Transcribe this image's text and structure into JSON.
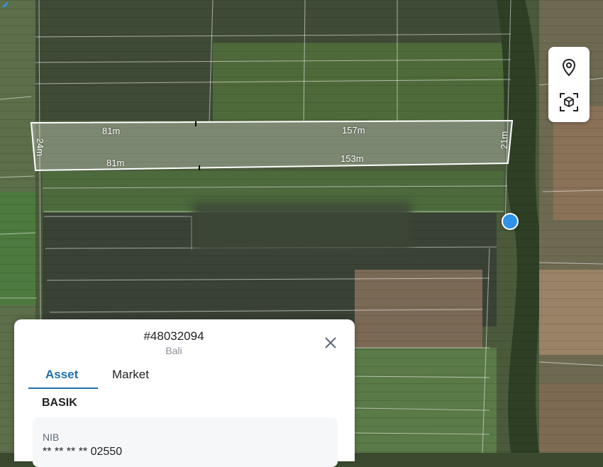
{
  "parcel": {
    "dimensions": {
      "top_left": "81m",
      "top_right": "157m",
      "bottom_left": "81m",
      "bottom_right": "153m",
      "left_side": "24m",
      "right_side": "21m"
    }
  },
  "map_controls": {
    "location_icon": "map-pin-icon",
    "cube_icon": "3d-cube-icon"
  },
  "panel": {
    "parcel_id": "#48032094",
    "region": "Bali",
    "close_icon": "close-icon",
    "tabs": [
      {
        "label": "Asset",
        "active": true
      },
      {
        "label": "Market",
        "active": false
      }
    ],
    "section_title": "BASIK",
    "field": {
      "label": "NIB",
      "value": "** ** ** ** 02550"
    }
  },
  "colors": {
    "accent": "#1f6fa8",
    "location_dot": "#2e93e6"
  }
}
